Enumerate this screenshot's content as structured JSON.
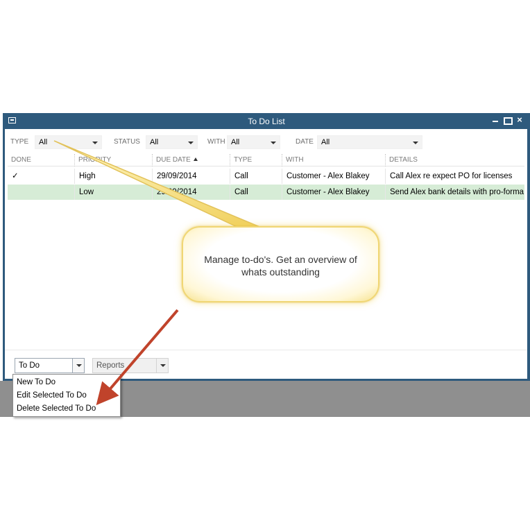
{
  "window": {
    "title": "To Do List",
    "close_glyph": "×"
  },
  "filters": {
    "type_label": "TYPE",
    "type_value": "All",
    "status_label": "STATUS",
    "status_value": "All",
    "with_label": "WITH",
    "with_value": "All",
    "date_label": "DATE",
    "date_value": "All"
  },
  "table": {
    "columns": [
      "DONE",
      "PRIORITY",
      "DUE DATE",
      "TYPE",
      "WITH",
      "DETAILS"
    ],
    "sort_column": "DUE DATE",
    "sort_direction": "ascending",
    "rows": [
      {
        "done": "✓",
        "priority": "High",
        "due_date": "29/09/2014",
        "type": "Call",
        "with": "Customer - Alex Blakey",
        "details": "Call Alex re expect PO for licenses",
        "selected": false
      },
      {
        "done": "",
        "priority": "Low",
        "due_date": "29/09/2014",
        "type": "Call",
        "with": "Customer - Alex Blakey",
        "details": "Send Alex bank details with pro-forma",
        "selected": true
      }
    ]
  },
  "bottom": {
    "todo_button": "To Do",
    "reports_button": "Reports"
  },
  "menu": {
    "items": [
      "New To Do",
      "Edit Selected To Do",
      "Delete Selected To Do"
    ]
  },
  "callout": {
    "line1": "Manage to-do's. Get an overview of",
    "line2": "whats outstanding"
  },
  "colors": {
    "titlebar": "#2e5a7d",
    "selected_row": "#d6ecd6",
    "callout_border": "#f0d674",
    "arrow": "#c0432b"
  },
  "icons": {
    "system_menu": "window-menu-icon",
    "minimize": "minimize-icon",
    "maximize": "maximize-icon",
    "close": "close-icon",
    "sort": "sort-ascending-icon",
    "dropdown": "chevron-down-icon"
  }
}
